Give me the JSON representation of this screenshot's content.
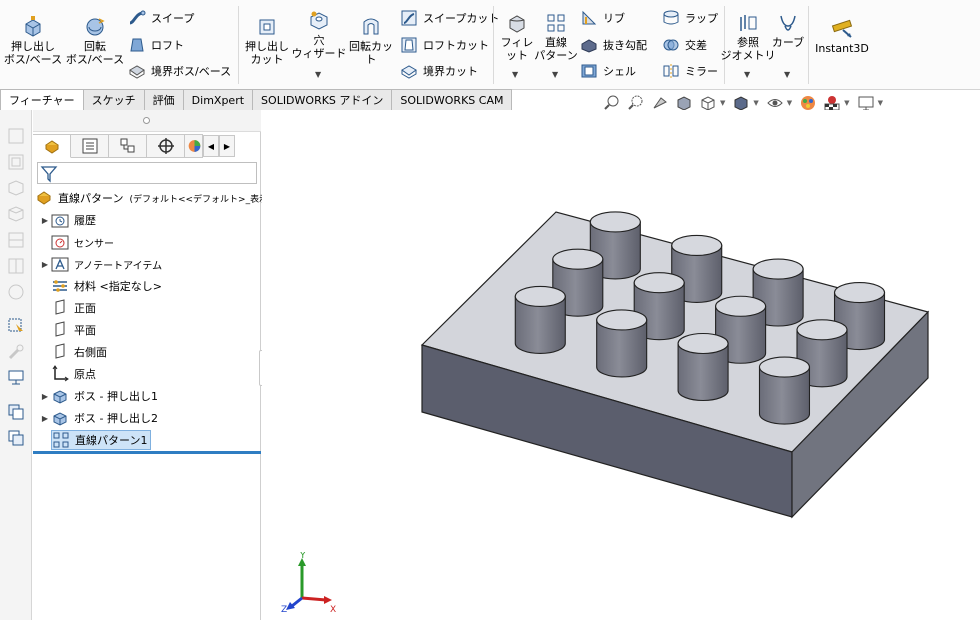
{
  "ribbon": {
    "extrude_boss": "押し出し\nボス/ベース",
    "revolve_boss": "回転\nボス/ベース",
    "sweep": "スイープ",
    "loft": "ロフト",
    "boundary_boss": "境界ボス/ベース",
    "extrude_cut": "押し出し\nカット",
    "hole_wizard": "穴\nウィザード",
    "revolve_cut": "回転カット",
    "sweep_cut": "スイープカット",
    "loft_cut": "ロフトカット",
    "boundary_cut": "境界カット",
    "fillet": "フィレット",
    "linear_pattern": "直線\nパターン",
    "rib": "リブ",
    "draft": "抜き勾配",
    "shell": "シェル",
    "wrap": "ラップ",
    "intersect": "交差",
    "mirror": "ミラー",
    "ref_geometry": "参照\nジオメトリ",
    "curves": "カーブ",
    "instant3d": "Instant3D"
  },
  "tabs": [
    {
      "label": "フィーチャー",
      "active": true
    },
    {
      "label": "スケッチ",
      "active": false
    },
    {
      "label": "評価",
      "active": false
    },
    {
      "label": "DimXpert",
      "active": false
    },
    {
      "label": "SOLIDWORKS アドイン",
      "active": false
    },
    {
      "label": "SOLIDWORKS CAM",
      "active": false
    }
  ],
  "tree": {
    "root": "直線パターン",
    "root_config": "(デフォルト<<デフォルト>_表示状",
    "history": "履歴",
    "sensors": "センサー",
    "annotations": "アノテートアイテム",
    "material": "材料 <指定なし>",
    "front_plane": "正面",
    "top_plane": "平面",
    "right_plane": "右側面",
    "origin": "原点",
    "boss_extrude1": "ボス - 押し出し1",
    "boss_extrude2": "ボス - 押し出し2",
    "linear_pattern1": "直線パターン1"
  },
  "triad": {
    "x": "X",
    "y": "Y",
    "z": "Z"
  },
  "colors": {
    "accent": "#2f7dc2",
    "model_top": "#d2d4da",
    "model_front": "#5b5e6d",
    "model_side": "#6f7280",
    "selection": "#cde3f7"
  }
}
